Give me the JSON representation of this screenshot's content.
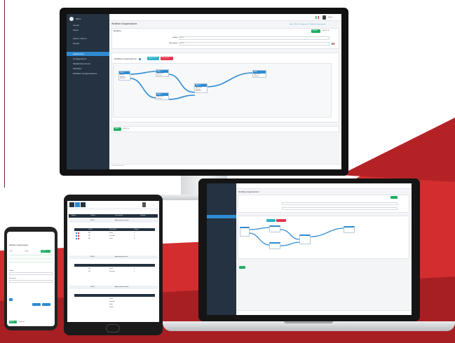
{
  "colors": {
    "brand_red": "#d32d2f",
    "dark_red": "#9c1e22",
    "sidebar": "#243241",
    "sidebar_active": "#2e8bd1",
    "primary_blue": "#2e8bd1",
    "success_green": "#1fae63",
    "danger_red": "#e5344d",
    "info_cyan": "#26b3c9",
    "device_black": "#151515"
  },
  "icons": [
    "avatar-icon",
    "home-icon",
    "user-icon",
    "users-icon",
    "workflow-icon",
    "circle-icon",
    "flag-icon",
    "search-icon",
    "grid-icon",
    "edit-icon",
    "delete-icon"
  ],
  "monitor": {
    "sidebar": {
      "user": "Mario",
      "items": [
        {
          "label": "Lavoro",
          "active": false
        },
        {
          "label": "Utenti",
          "active": false
        },
        {
          "label": "Utenti / Interno",
          "active": false
        },
        {
          "label": "Gruppi",
          "active": false
        },
        {
          "label": "Applicazioni",
          "active": true
        },
        {
          "label": "Configurazioni",
          "active": false
        },
        {
          "label": "Modelli documento",
          "active": false
        },
        {
          "label": "Workflow",
          "active": false
        },
        {
          "label": "Workflow di approvazione",
          "active": false
        }
      ]
    },
    "topbar": {
      "user_label": "Utente"
    },
    "page": {
      "title": "Workflow di approvazione",
      "breadcrumb": "Home / Flussi / Configurazione / Workflow di approvazione",
      "card_title": "Modifica",
      "save_label": "SALVA",
      "cancel_label": "ANNULLA",
      "fields": [
        {
          "label": "Codice",
          "value": "WF01"
        },
        {
          "label": "Descrizione",
          "value": "WF01"
        }
      ],
      "flow_title": "Workflow di approvazione",
      "add_step_label": "Aggiungi step",
      "remove_step_label": "Rimuovi step",
      "nodes": [
        {
          "title": "Inizio",
          "rows": [
            "Inviato",
            "Rifiutato",
            "Annullato"
          ]
        },
        {
          "title": "Step 1",
          "rows": [
            "Approvato",
            "Rifiutato"
          ]
        },
        {
          "title": "Step 2",
          "rows": [
            "Approvato",
            "Rifiutato"
          ]
        },
        {
          "title": "Step 3",
          "rows": [
            "Approvato",
            "Rifiutato",
            "Annullato"
          ]
        },
        {
          "title": "Fine",
          "rows": [
            "Approvato",
            "Rifiutato"
          ]
        }
      ],
      "bottom_save": "SALVA",
      "bottom_cancel": "ANNULLA",
      "footer": "Powered by Iterazione"
    }
  },
  "tablet": {
    "grid_header": [
      "Azioni",
      "Codice",
      "Descrizione",
      "Gruppo"
    ],
    "subheader": [
      "Azioni",
      "Livello",
      "Descrizione",
      "Gruppo"
    ],
    "groups": [
      {
        "code": "WF01",
        "desc": "Approvazione spese",
        "rows": [
          [
            "GR",
            "Primo",
            "1"
          ],
          [
            "GR",
            "Secondo",
            "2"
          ],
          [
            "GR",
            "Terzo",
            "3"
          ]
        ]
      },
      {
        "code": "WF02",
        "desc": "Approvazione ferie",
        "rows": [
          [
            "GR",
            "Primo",
            "1"
          ],
          [
            "GR",
            "Secondo",
            "2"
          ]
        ]
      },
      {
        "code": "WF03",
        "desc": "Approvazione ordini",
        "rows": [
          [
            "GR",
            "Primo",
            "1"
          ],
          [
            "GR",
            "Secondo",
            "2"
          ],
          [
            "GR",
            "Terzo",
            "3"
          ],
          [
            "GR",
            "Quarto",
            "4"
          ]
        ]
      }
    ]
  },
  "phone": {
    "title": "Workflow di approvazione",
    "tabs": [
      "Dati",
      "Step",
      "Utenti"
    ],
    "fields": [
      "Codice",
      "Descrizione"
    ],
    "save": "SALVA",
    "cancel": "ANNULLA"
  }
}
